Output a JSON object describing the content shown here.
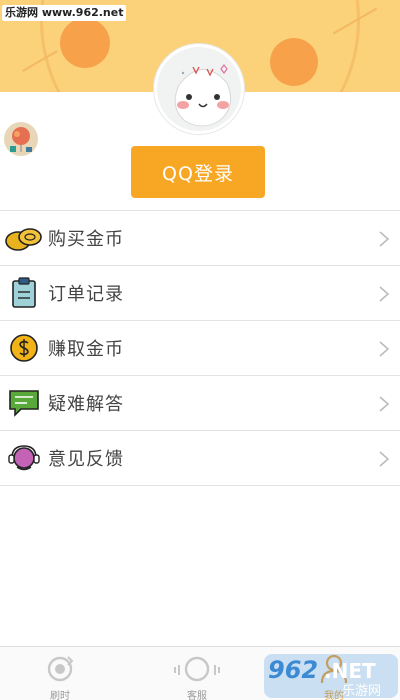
{
  "watermark": {
    "text": "乐游网 www.962.net"
  },
  "login": {
    "button_label": "QQ登录"
  },
  "menu": {
    "items": [
      {
        "label": "购买金币",
        "icon": "coins-icon"
      },
      {
        "label": "订单记录",
        "icon": "clipboard-icon"
      },
      {
        "label": "赚取金币",
        "icon": "dollar-coin-icon"
      },
      {
        "label": "疑难解答",
        "icon": "chat-bubble-icon"
      },
      {
        "label": "意见反馈",
        "icon": "headset-icon"
      }
    ]
  },
  "tabs": [
    {
      "label": "刷时",
      "icon": "refresh-icon"
    },
    {
      "label": "客服",
      "icon": "headphones-icon"
    },
    {
      "label": "我的",
      "icon": "user-icon",
      "active": true
    }
  ],
  "brand": {
    "number": "962",
    "suffix": ".NET",
    "cn": "乐游网"
  },
  "colors": {
    "accent": "#f7a723",
    "banner": "#fbd27a",
    "divider": "#e3e3e3"
  }
}
